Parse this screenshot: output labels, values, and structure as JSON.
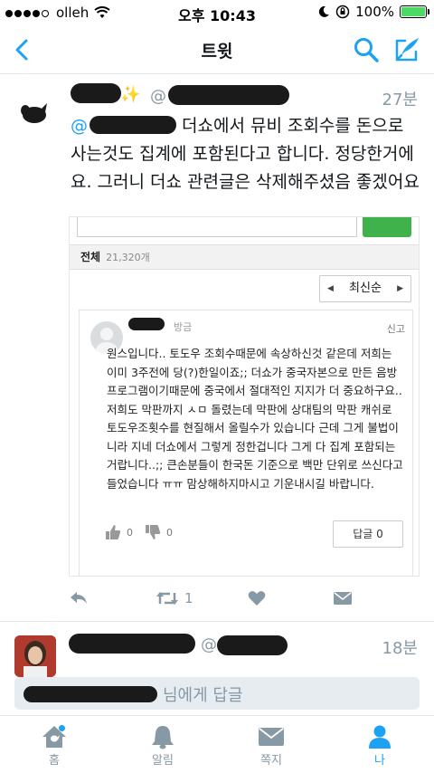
{
  "status_bar": {
    "carrier": "olleh",
    "time": "오후 10:43",
    "battery": "100%",
    "battery_level": 1.0
  },
  "nav": {
    "title": "트윗"
  },
  "tweet": {
    "at_symbol": "@",
    "time": "27분",
    "mention_prefix": "@",
    "text": "더쇼에서 뮤비 조회수를 돈으로 사는것도 집계에 포함된다고 합니다. 정당한거에요. 그러니 더쇼 관련글은 삭제해주셨음 좋겠어요",
    "sparkle": "✨"
  },
  "embed": {
    "total_label": "전체",
    "total_count": "21,320개",
    "sort_label": "최신순",
    "comment": {
      "time": "방금",
      "report": "신고",
      "body": "원스입니다.. 토도우 조회수때문에 속상하신것 같은데 저희는 이미 3주전에 당(?)한일이죠;; 더쇼가 중국자본으로 만든 음방프로그램이기때문에 중국에서 절대적인 지지가 더 중요하구요.. 저희도 막판까지 ㅅㅁ 돌렸는데 막판에 상대팀의 막판 캐쉬로 토도우조횟수를 현질해서 올릴수가 있습니다 근데 그게 불법이니라 지네 더쇼에서 그렇게 정한겁니다 그게 다 집계 포함되는거랍니다..;; 큰손분들이 한국돈 기준으로 백만 단위로 쓰신다고 들었습니다 ㅠㅠ 맘상해하지마시고 기운내시길 바랍니다.",
      "like_count": "0",
      "dislike_count": "0",
      "reply_label": "답글 0"
    }
  },
  "actions": {
    "retweet_count": "1"
  },
  "tweet2": {
    "at_symbol": "@",
    "time": "18분"
  },
  "reply_bar": {
    "placeholder": "님에게 답글"
  },
  "tabs": [
    {
      "label": "홈",
      "icon": "home-icon"
    },
    {
      "label": "알림",
      "icon": "bell-icon"
    },
    {
      "label": "쪽지",
      "icon": "envelope-icon"
    },
    {
      "label": "나",
      "icon": "person-icon"
    }
  ],
  "colors": {
    "accent": "#1da1f2",
    "muted": "#8899a6",
    "embed_green": "#3fb24b"
  }
}
